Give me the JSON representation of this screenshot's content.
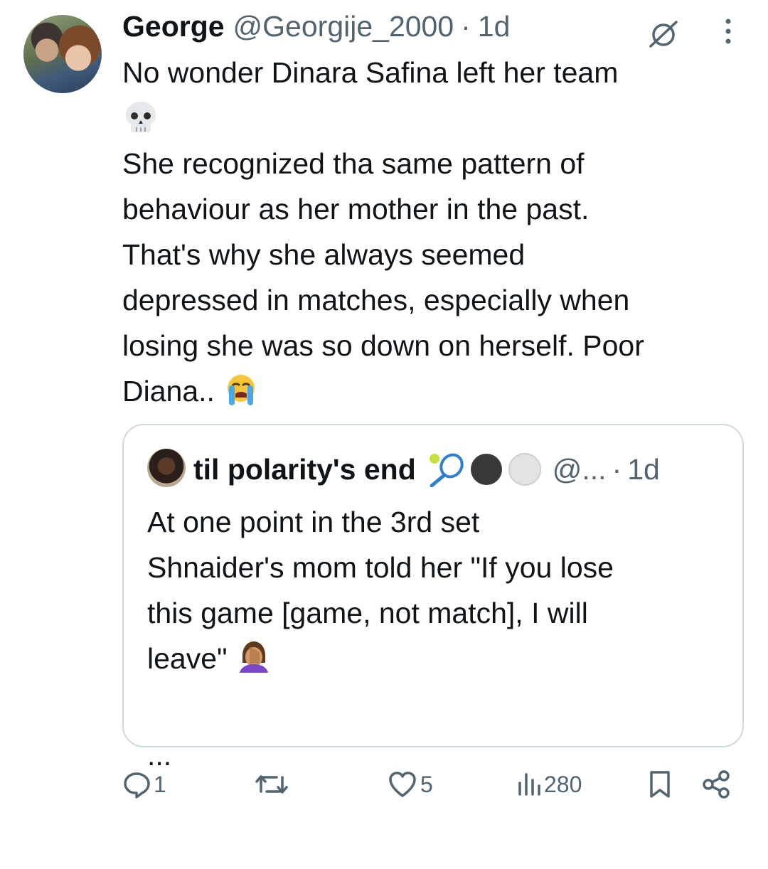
{
  "tweet": {
    "author_name": "George",
    "handle": "@Georgije_2000",
    "separator": "·",
    "time": "1d",
    "text_line1": "No wonder Dinara Safina left her team",
    "text_body": "She recognized tha same pattern of\nbehaviour as her mother in the past.\nThat's why she always seemed\ndepressed in matches, especially when\nlosing she was so down on herself. Poor\nDiana.. "
  },
  "quote": {
    "author_name": "til polarity's end",
    "handle": "@...",
    "separator": "·",
    "time": "1d",
    "text": "At one point in the 3rd set\nShnaider's mom told her \"If you lose\nthis game [game, not match], I will\nleave\" ",
    "ellipsis": "..."
  },
  "actions": {
    "replies": "1",
    "retweets": "",
    "likes": "5",
    "views": "280"
  },
  "icons": {
    "grok": "grok-icon",
    "more": "more-icon",
    "reply": "reply-icon",
    "retweet": "retweet-icon",
    "like": "heart-icon",
    "views": "views-icon",
    "bookmark": "bookmark-icon",
    "share": "share-icon"
  },
  "colors": {
    "text": "#0f1419",
    "muted": "#536471",
    "border": "#cfd9de"
  }
}
